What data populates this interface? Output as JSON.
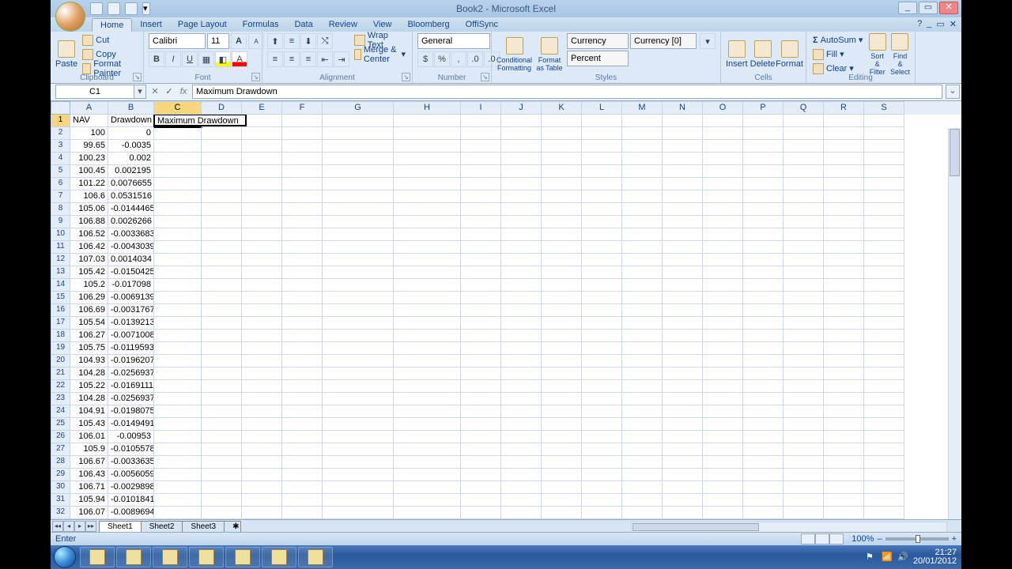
{
  "window": {
    "title": "Book2 - Microsoft Excel",
    "min": "_",
    "max": "▭",
    "close": "✕"
  },
  "qat": {
    "save": "save-icon",
    "undo": "undo-icon",
    "redo": "redo-icon"
  },
  "tabs": {
    "items": [
      "Home",
      "Insert",
      "Page Layout",
      "Formulas",
      "Data",
      "Review",
      "View",
      "Bloomberg",
      "OffiSync"
    ],
    "active": 0,
    "help": "?",
    "min_ribbon": "_",
    "restore": "▭",
    "close": "✕"
  },
  "ribbon": {
    "clipboard": {
      "label": "Clipboard",
      "paste": "Paste",
      "cut": "Cut",
      "copy": "Copy",
      "fmtpainter": "Format Painter"
    },
    "font": {
      "label": "Font",
      "name": "Calibri",
      "size": "11",
      "bold": "B",
      "italic": "I",
      "under": "U",
      "grow": "A",
      "shrink": "A"
    },
    "alignment": {
      "label": "Alignment",
      "wrap": "Wrap Text",
      "merge": "Merge & Center"
    },
    "number": {
      "label": "Number",
      "format": "General"
    },
    "styles": {
      "label": "Styles",
      "cond": "Conditional Formatting",
      "table": "Format as Table",
      "cur": "Currency",
      "cur0": "Currency [0]",
      "pct": "Percent"
    },
    "cells": {
      "label": "Cells",
      "insert": "Insert",
      "delete": "Delete",
      "format": "Format"
    },
    "editing": {
      "label": "Editing",
      "autosum": "AutoSum",
      "fill": "Fill",
      "clear": "Clear",
      "sort": "Sort & Filter",
      "find": "Find & Select"
    }
  },
  "formula_bar": {
    "namebox": "C1",
    "cancel": "✕",
    "enter": "✓",
    "fx": "fx",
    "value": "Maximum Drawdown"
  },
  "columns": [
    {
      "l": "A",
      "w": 48
    },
    {
      "l": "B",
      "w": 58
    },
    {
      "l": "C",
      "w": 60
    },
    {
      "l": "D",
      "w": 51
    },
    {
      "l": "E",
      "w": 51
    },
    {
      "l": "F",
      "w": 51
    },
    {
      "l": "G",
      "w": 90
    },
    {
      "l": "H",
      "w": 85
    },
    {
      "l": "I",
      "w": 51
    },
    {
      "l": "J",
      "w": 51
    },
    {
      "l": "K",
      "w": 51
    },
    {
      "l": "L",
      "w": 51
    },
    {
      "l": "M",
      "w": 51
    },
    {
      "l": "N",
      "w": 51
    },
    {
      "l": "O",
      "w": 51
    },
    {
      "l": "P",
      "w": 51
    },
    {
      "l": "Q",
      "w": 51
    },
    {
      "l": "R",
      "w": 51
    },
    {
      "l": "S",
      "w": 51
    }
  ],
  "selected_col_index": 2,
  "selected_row": 1,
  "edit_cell": {
    "row": 1,
    "col": 2,
    "text": "Maximum Drawdown",
    "width": 118
  },
  "rows": [
    {
      "n": 1,
      "A": "NAV",
      "A_align": "l",
      "B": "Drawdown",
      "B_align": "l",
      "C": "Maximum Drawdown",
      "C_align": "l"
    },
    {
      "n": 2,
      "A": "100",
      "B": "0"
    },
    {
      "n": 3,
      "A": "99.65",
      "B": "-0.0035"
    },
    {
      "n": 4,
      "A": "100.23",
      "B": "0.002"
    },
    {
      "n": 5,
      "A": "100.45",
      "B": "0.002195"
    },
    {
      "n": 6,
      "A": "101.22",
      "B": "0.0076655"
    },
    {
      "n": 7,
      "A": "106.6",
      "B": "0.0531516"
    },
    {
      "n": 8,
      "A": "105.06",
      "B": "-0.0144465"
    },
    {
      "n": 9,
      "A": "106.88",
      "B": "0.0026266"
    },
    {
      "n": 10,
      "A": "106.52",
      "B": "-0.0033683"
    },
    {
      "n": 11,
      "A": "106.42",
      "B": "-0.0043039"
    },
    {
      "n": 12,
      "A": "107.03",
      "B": "0.0014034"
    },
    {
      "n": 13,
      "A": "105.42",
      "B": "-0.0150425"
    },
    {
      "n": 14,
      "A": "105.2",
      "B": "-0.017098"
    },
    {
      "n": 15,
      "A": "106.29",
      "B": "-0.0069139"
    },
    {
      "n": 16,
      "A": "106.69",
      "B": "-0.0031767"
    },
    {
      "n": 17,
      "A": "105.54",
      "B": "-0.0139213"
    },
    {
      "n": 18,
      "A": "106.27",
      "B": "-0.0071008"
    },
    {
      "n": 19,
      "A": "105.75",
      "B": "-0.0119593"
    },
    {
      "n": 20,
      "A": "104.93",
      "B": "-0.0196207"
    },
    {
      "n": 21,
      "A": "104.28",
      "B": "-0.0256937"
    },
    {
      "n": 22,
      "A": "105.22",
      "B": "-0.0169111"
    },
    {
      "n": 23,
      "A": "104.28",
      "B": "-0.0256937"
    },
    {
      "n": 24,
      "A": "104.91",
      "B": "-0.0198075"
    },
    {
      "n": 25,
      "A": "105.43",
      "B": "-0.0149491"
    },
    {
      "n": 26,
      "A": "106.01",
      "B": "-0.00953"
    },
    {
      "n": 27,
      "A": "105.9",
      "B": "-0.0105578"
    },
    {
      "n": 28,
      "A": "106.67",
      "B": "-0.0033635"
    },
    {
      "n": 29,
      "A": "106.43",
      "B": "-0.0056059"
    },
    {
      "n": 30,
      "A": "106.71",
      "B": "-0.0029898"
    },
    {
      "n": 31,
      "A": "105.94",
      "B": "-0.0101841"
    },
    {
      "n": 32,
      "A": "106.07",
      "B": "-0.0089694"
    }
  ],
  "sheets": {
    "nav": [
      "◂◂",
      "◂",
      "▸",
      "▸▸"
    ],
    "tabs": [
      "Sheet1",
      "Sheet2",
      "Sheet3"
    ],
    "active": 0,
    "new": "✱"
  },
  "status": {
    "mode": "Enter",
    "zoom": "100%",
    "zoom_minus": "–",
    "zoom_plus": "+"
  },
  "taskbar": {
    "apps": [
      "ie",
      "explorer",
      "wmp",
      "outlook",
      "skype",
      "excel",
      "other"
    ],
    "clock_time": "21:27",
    "clock_date": "20/01/2012"
  }
}
